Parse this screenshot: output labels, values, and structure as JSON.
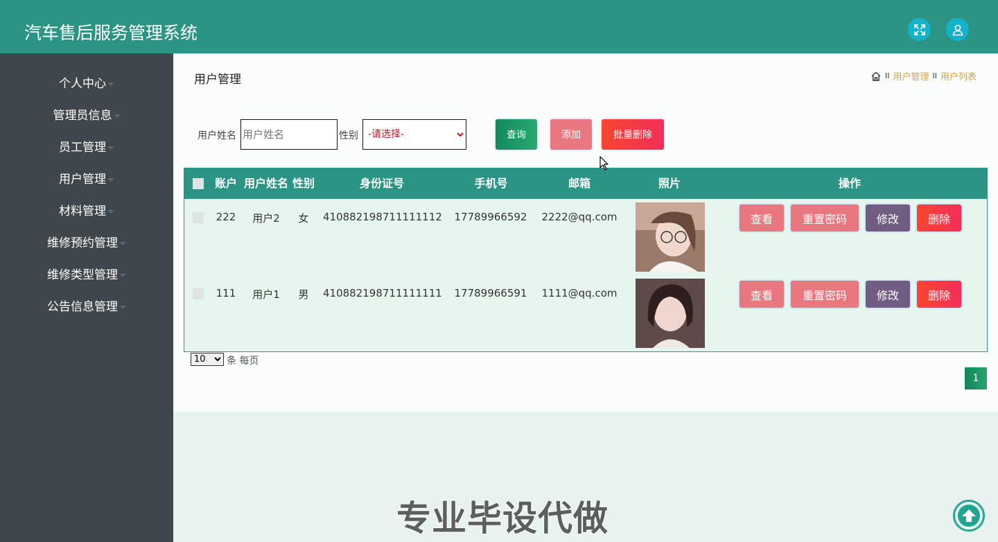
{
  "header": {
    "title": "汽车售后服务管理系统",
    "fullscreen_icon": "expand-icon",
    "user_icon": "user-icon"
  },
  "sidebar": {
    "items": [
      {
        "label": "个人中心"
      },
      {
        "label": "管理员信息"
      },
      {
        "label": "员工管理"
      },
      {
        "label": "用户管理"
      },
      {
        "label": "材料管理"
      },
      {
        "label": "维修预约管理"
      },
      {
        "label": "维修类型管理"
      },
      {
        "label": "公告信息管理"
      }
    ]
  },
  "page": {
    "title": "用户管理",
    "breadcrumb": {
      "home_icon": "home-icon",
      "separator": "II",
      "items": [
        "用户管理",
        "用户列表"
      ]
    }
  },
  "search": {
    "name_label": "用户姓名",
    "name_placeholder": "用户姓名",
    "gender_label": "性别",
    "gender_selected": "-请选择-",
    "query_button": "查询",
    "add_button": "添加",
    "batch_delete_button": "批量删除"
  },
  "table": {
    "columns": [
      "账户",
      "用户姓名",
      "性别",
      "身份证号",
      "手机号",
      "邮箱",
      "照片",
      "操作"
    ],
    "rows": [
      {
        "account": "222",
        "name": "用户2",
        "gender": "女",
        "id_number": "410882198711111112",
        "phone": "17789966592",
        "email": "2222@qq.com"
      },
      {
        "account": "111",
        "name": "用户1",
        "gender": "男",
        "id_number": "410882198711111111",
        "phone": "17789966591",
        "email": "1111@qq.com"
      }
    ],
    "actions": {
      "view": "查看",
      "reset_password": "重置密码",
      "edit": "修改",
      "delete": "删除"
    }
  },
  "pagination": {
    "page_size": "10",
    "per_page_text": "条 每页",
    "current_page": "1"
  },
  "watermark": "专业毕设代做",
  "colors": {
    "topbar": "#2b9484",
    "sidebar": "#3f474d",
    "query_button": "#1a9a6a",
    "add_button": "#e9777f",
    "batch_delete_button": "#f8393f",
    "reset_password_button": "#e9777f",
    "edit_button": "#725d82",
    "delete_button": "#f8393f"
  }
}
